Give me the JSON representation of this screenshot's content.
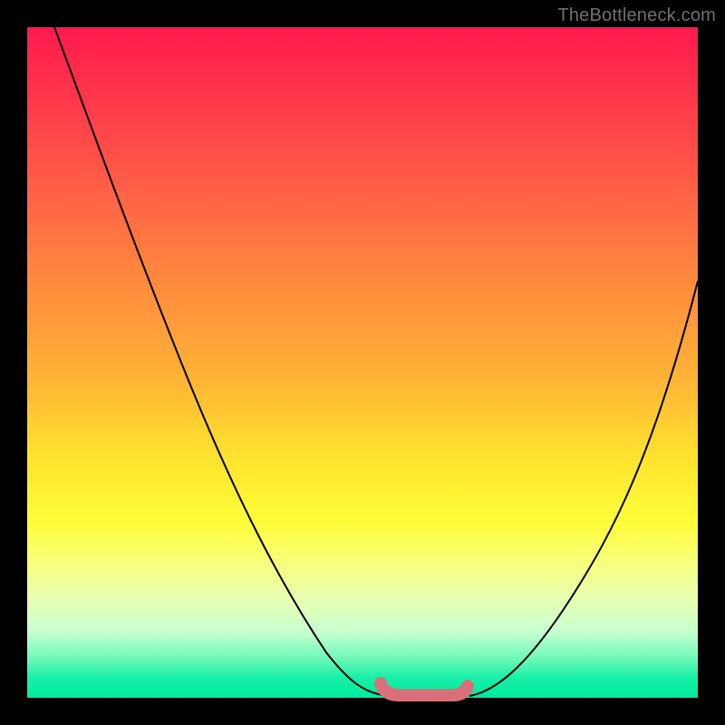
{
  "watermark": "TheBottleneck.com",
  "colors": {
    "trough": "#d97079",
    "curve": "#000000"
  },
  "chart_data": {
    "type": "line",
    "title": "",
    "xlabel": "",
    "ylabel": "",
    "xlim": [
      0,
      100
    ],
    "ylim": [
      0,
      100
    ],
    "series": [
      {
        "name": "left-curve",
        "x": [
          4,
          10,
          16,
          22,
          28,
          34,
          40,
          46,
          50,
          54
        ],
        "y": [
          100,
          85,
          71,
          58,
          46,
          35,
          25,
          14,
          6,
          0
        ]
      },
      {
        "name": "right-curve",
        "x": [
          66,
          72,
          78,
          84,
          90,
          96,
          100
        ],
        "y": [
          0,
          9,
          19,
          30,
          42,
          54,
          62
        ]
      },
      {
        "name": "trough-highlight",
        "x": [
          53,
          56,
          60,
          63,
          65
        ],
        "y": [
          1.2,
          0.4,
          0.3,
          0.4,
          1.2
        ]
      }
    ],
    "annotations": [
      {
        "name": "trough-start-dot",
        "x": 53,
        "y": 1.8
      }
    ]
  }
}
